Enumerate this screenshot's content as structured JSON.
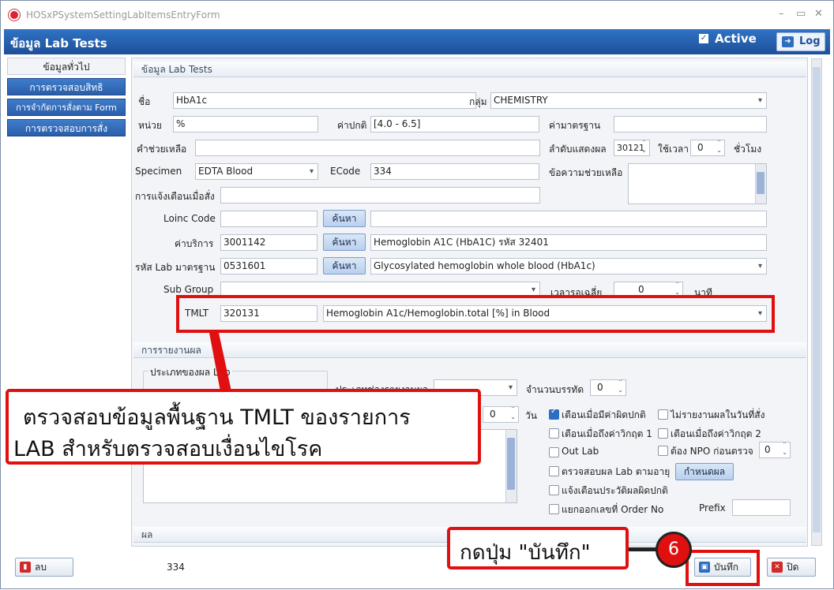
{
  "window": {
    "title": "HOSxPSystemSettingLabItemsEntryForm",
    "minimize": "–",
    "maximize": "▭"
  },
  "header": {
    "title": "ข้อมูล Lab Tests",
    "active_label": "Active",
    "active_checked": true,
    "log_label": "Log"
  },
  "sidebar": {
    "items": [
      {
        "label": "ข้อมูลทั่วไป",
        "selected": true
      },
      {
        "label": "การตรวจสอบสิทธิ",
        "selected": false
      },
      {
        "label": "การจำกัดการสั่งตาม Form",
        "selected": false
      },
      {
        "label": "การตรวจสอบการสั่ง",
        "selected": false
      }
    ]
  },
  "lab_group": {
    "title": "ข้อมูล Lab Tests",
    "name_label": "ชื่อ",
    "name_value": "HbA1c",
    "group_label": "กลุ่ม",
    "group_value": "CHEMISTRY",
    "unit_label": "หน่วย",
    "unit_value": "%",
    "normal_label": "ค่าปกติ",
    "normal_value": "[4.0 - 6.5]",
    "standard_label": "ค่ามาตรฐาน",
    "standard_value": "",
    "help_label": "คำช่วยเหลือ",
    "help_value": "",
    "order_label": "ลำดับแสดงผล",
    "order_value": "30121",
    "time_label": "ใช้เวลา",
    "time_value": "0",
    "hour_label": "ชั่วโมง",
    "specimen_label": "Specimen",
    "specimen_value": "EDTA Blood",
    "ecode_label": "ECode",
    "ecode_value": "334",
    "helpmsg_label": "ข้อความช่วยเหลือ",
    "notify_label": "การแจ้งเตือนเมื่อสั่ง",
    "notify_value": "",
    "loinc_label": "Loinc Code",
    "loinc_value": "",
    "loinc_desc": "",
    "search_label": "ค้นหา",
    "service_label": "ค่าบริการ",
    "service_value": "3001142",
    "service_desc": "Hemoglobin A1C (HbA1C) รหัส 32401",
    "stdlab_label": "รหัส Lab มาตรฐาน",
    "stdlab_value": "0531601",
    "stdlab_desc": "Glycosylated hemoglobin whole blood (HbA1c)",
    "subgroup_label": "Sub Group",
    "subgroup_value": "",
    "avgtime_label": "เวลารอเฉลี่ย",
    "avgtime_value": "0",
    "minute_label": "นาที",
    "tmlt_label": "TMLT",
    "tmlt_value": "320131",
    "tmlt_desc": "Hemoglobin A1c/Hemoglobin.total [%] in Blood"
  },
  "report_group": {
    "title": "การรายงานผล",
    "result_type_label": "ประเภทของผล Lab",
    "field_type_label": "ประเภทช่องรายงานผล",
    "field_type_value": "",
    "lines_label": "จำนวนบรรทัด",
    "lines_value": "0",
    "days_value": "0",
    "days_label": "วัน",
    "checks": [
      {
        "label": "เตือนเมื่อมีค่าผิดปกติ",
        "on": true
      },
      {
        "label": "ไม่รายงานผลในวันที่สั่ง",
        "on": false
      },
      {
        "label": "เตือนเมื่อถึงค่าวิกฤต 1",
        "on": false
      },
      {
        "label": "เตือนเมื่อถึงค่าวิกฤต 2",
        "on": false
      },
      {
        "label": "Out Lab",
        "on": false
      },
      {
        "label": "ต้อง NPO ก่อนตรวจ",
        "on": false
      },
      {
        "label": "ตรวจสอบผล Lab ตามอายุ",
        "on": false
      },
      {
        "label": "แจ้งเตือนประวัติผลผิดปกติ",
        "on": false
      },
      {
        "label": "แยกออกเลขที่ Order No",
        "on": false
      }
    ],
    "npo_value": "0",
    "define_label": "กำหนดผล",
    "prefix_label": "Prefix",
    "prefix_value": ""
  },
  "result_group": {
    "title": "ผล"
  },
  "footer": {
    "delete_label": "ลบ",
    "code_value": "334",
    "save_label": "บันทึก",
    "close_label": "ปิด"
  },
  "annotations": {
    "callout_text_1": "ตรวจสอบข้อมูลพื้นฐาน TMLT ของรายการ",
    "callout_text_2": "LAB สำหรับตรวจสอบเงื่อนไขโรค",
    "save_callout": "กดปุ่ม \"บันทึก\"",
    "step_number": "6"
  },
  "colors": {
    "header": "#2f73c4",
    "highlight": "#e01010"
  }
}
